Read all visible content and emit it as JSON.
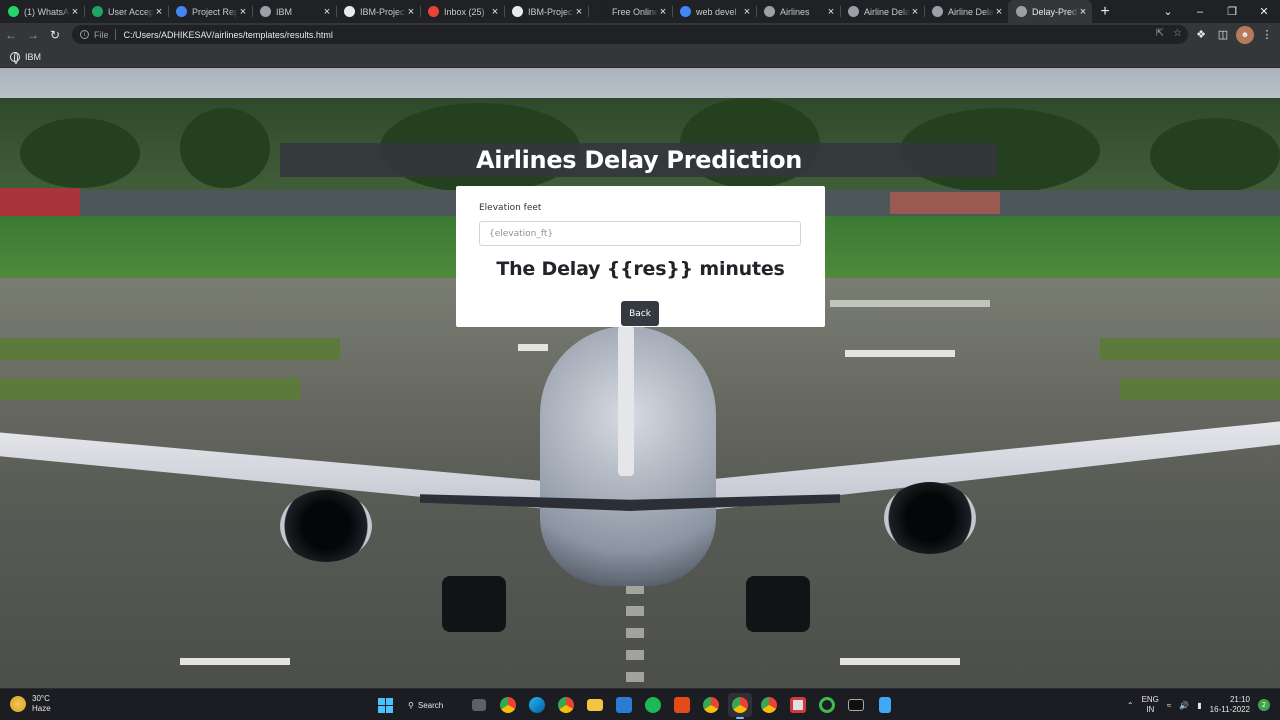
{
  "browser": {
    "tabs": [
      {
        "title": "(1) WhatsApp",
        "color": "#25d366",
        "icon": "whatsapp-icon"
      },
      {
        "title": "User Acceptance",
        "color": "#1fa463",
        "icon": "google-drive-icon"
      },
      {
        "title": "Project Report",
        "color": "#4285f4",
        "icon": "google-docs-icon"
      },
      {
        "title": "IBM",
        "color": "#9aa0a6",
        "icon": "globe-icon"
      },
      {
        "title": "IBM-Project",
        "color": "#e8eaed",
        "icon": "github-icon"
      },
      {
        "title": "Inbox (25)",
        "color": "#ea4335",
        "icon": "gmail-icon"
      },
      {
        "title": "IBM-Project",
        "color": "#e8eaed",
        "icon": "github-icon"
      },
      {
        "title": "Free Online",
        "color": "#202124",
        "icon": "v-icon"
      },
      {
        "title": "web devel",
        "color": "#4285f4",
        "icon": "google-icon"
      },
      {
        "title": "Airlines",
        "color": "#9aa0a6",
        "icon": "globe-icon"
      },
      {
        "title": "Airline Delay",
        "color": "#9aa0a6",
        "icon": "globe-icon"
      },
      {
        "title": "Airline Delay",
        "color": "#9aa0a6",
        "icon": "globe-icon"
      },
      {
        "title": "Delay-Prediction",
        "color": "#9aa0a6",
        "icon": "globe-icon",
        "active": true
      }
    ],
    "address": {
      "scheme_label": "File",
      "url": "C:/Users/ADHIKESAV/airlines/templates/results.html"
    },
    "bookmark": "IBM"
  },
  "page": {
    "title": "Airlines Delay Prediction",
    "form": {
      "label": "Elevation feet",
      "placeholder": "{elevation_ft}"
    },
    "result": "The Delay {{res}} minutes",
    "back_label": "Back"
  },
  "taskbar": {
    "weather_temp": "30°C",
    "weather_desc": "Haze",
    "search_label": "Search",
    "lang_line1": "ENG",
    "lang_line2": "IN",
    "time": "21:10",
    "date": "16-11-2022",
    "notifications": "2"
  }
}
